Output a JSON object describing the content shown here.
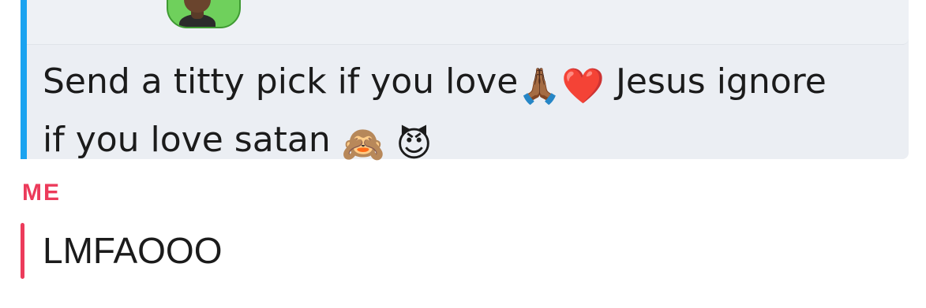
{
  "incoming_message": {
    "line1_text": "Send a titty pick if you love",
    "line1_emoji_praying": "🙏🏾",
    "line1_emoji_heart": "❤️",
    "line1_text_end": " Jesus ignore",
    "line2_text": "if you love satan ",
    "line2_emoji_monkey": "🙈",
    "line2_emoji_devil": "😈",
    "bar_color": "#1aa3f0"
  },
  "outgoing_message": {
    "sender_label": "ME",
    "text": "LMFAOOO",
    "bar_color": "#ec3b5b"
  }
}
